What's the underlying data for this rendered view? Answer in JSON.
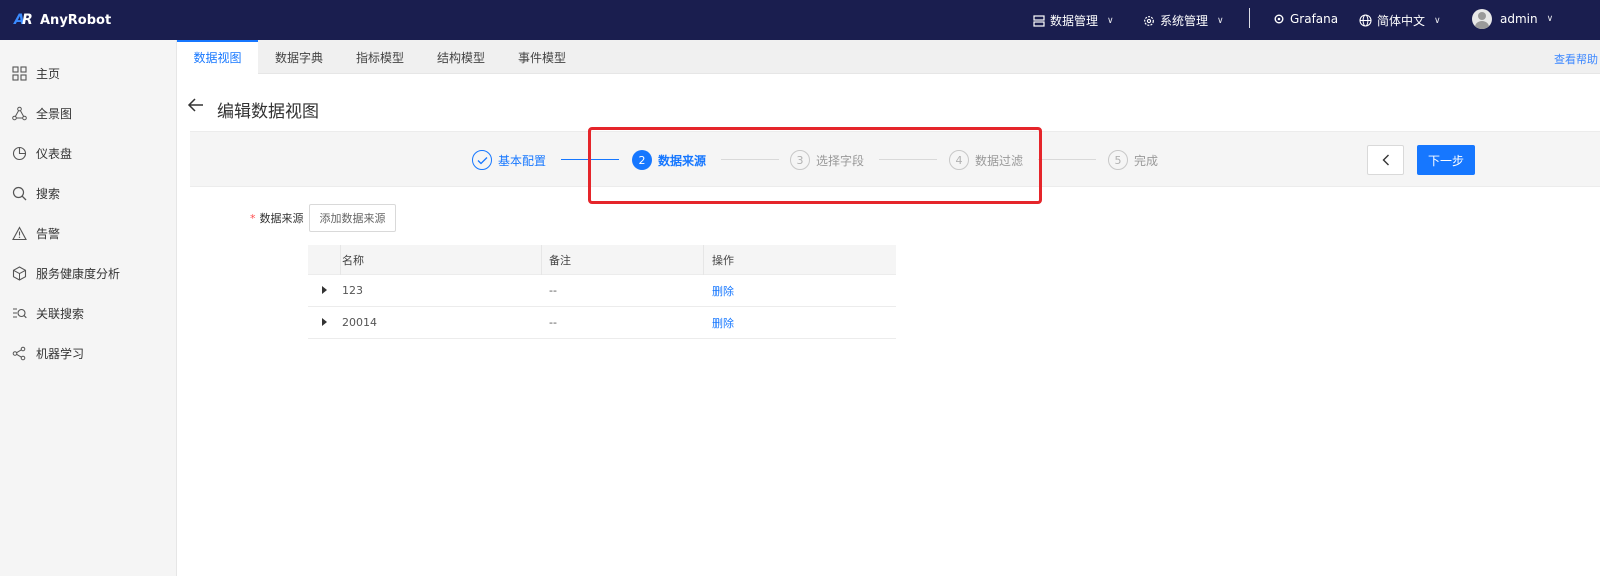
{
  "app": {
    "name": "AnyRobot",
    "logo_mark": "AR"
  },
  "topbar": {
    "data_mgmt": "数据管理",
    "sys_mgmt": "系统管理",
    "grafana": "Grafana",
    "language": "简体中文",
    "user": "admin"
  },
  "sidebar": {
    "items": [
      {
        "label": "主页",
        "icon": "grid-icon"
      },
      {
        "label": "全景图",
        "icon": "topology-icon"
      },
      {
        "label": "仪表盘",
        "icon": "pie-chart-icon"
      },
      {
        "label": "搜索",
        "icon": "search-icon"
      },
      {
        "label": "告警",
        "icon": "warning-icon"
      },
      {
        "label": "服务健康度分析",
        "icon": "cube-icon"
      },
      {
        "label": "关联搜索",
        "icon": "list-search-icon"
      },
      {
        "label": "机器学习",
        "icon": "nodes-icon"
      }
    ]
  },
  "tabs": [
    {
      "label": "数据视图",
      "active": true
    },
    {
      "label": "数据字典",
      "active": false
    },
    {
      "label": "指标模型",
      "active": false
    },
    {
      "label": "结构模型",
      "active": false
    },
    {
      "label": "事件模型",
      "active": false
    }
  ],
  "help_link": "查看帮助",
  "page": {
    "title": "编辑数据视图"
  },
  "steps": [
    {
      "num": "✓",
      "label": "基本配置",
      "state": "done"
    },
    {
      "num": "2",
      "label": "数据来源",
      "state": "current"
    },
    {
      "num": "3",
      "label": "选择字段",
      "state": "todo"
    },
    {
      "num": "4",
      "label": "数据过滤",
      "state": "todo"
    },
    {
      "num": "5",
      "label": "完成",
      "state": "todo"
    }
  ],
  "buttons": {
    "prev": "‹",
    "next": "下一步",
    "add_source": "添加数据来源"
  },
  "form": {
    "source_label": "数据来源",
    "required_mark": "*"
  },
  "table": {
    "headers": [
      "名称",
      "备注",
      "操作"
    ],
    "rows": [
      {
        "name": "123",
        "note": "--",
        "action": "删除"
      },
      {
        "name": "20014",
        "note": "--",
        "action": "删除"
      }
    ]
  },
  "colors": {
    "topbar": "#1a1e4f",
    "primary": "#1677ff",
    "highlight": "#e5252a"
  }
}
